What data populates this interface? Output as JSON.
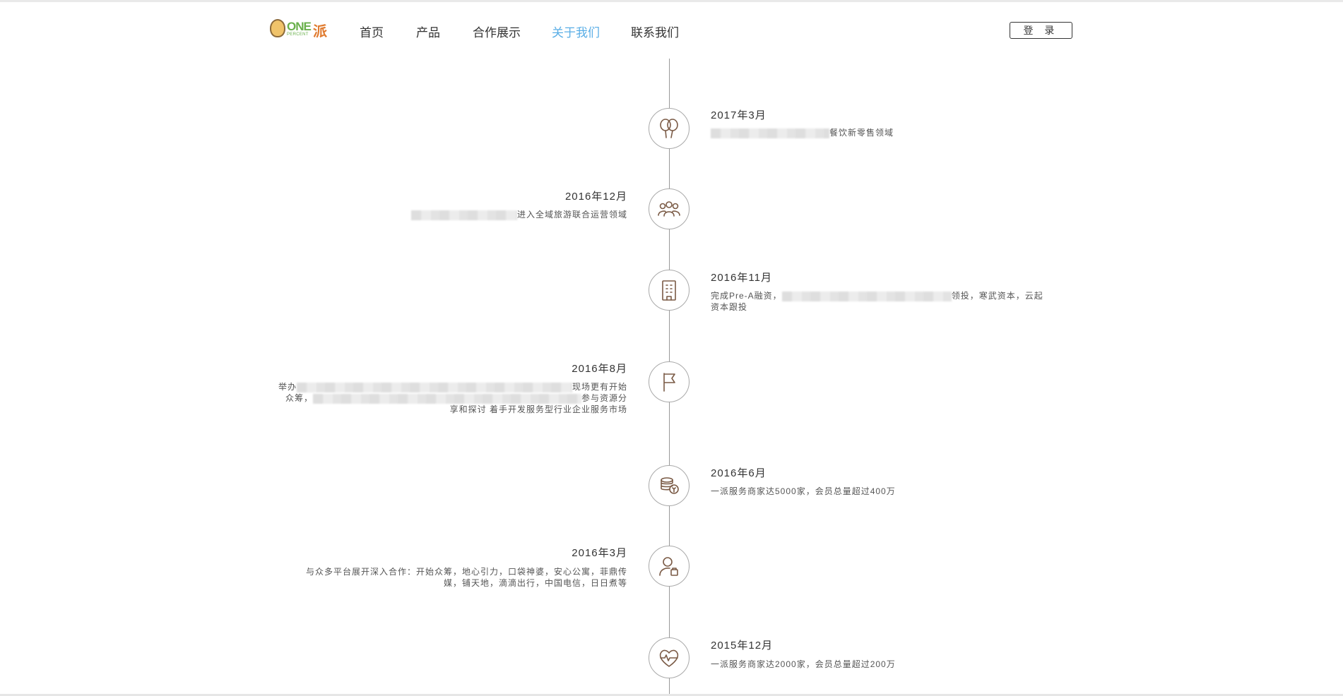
{
  "header": {
    "logo": {
      "one": "ONE",
      "percent": "PERCENT",
      "pai": "派"
    },
    "nav": [
      {
        "label": "首页",
        "active": false
      },
      {
        "label": "产品",
        "active": false
      },
      {
        "label": "合作展示",
        "active": false
      },
      {
        "label": "关于我们",
        "active": true
      },
      {
        "label": "联系我们",
        "active": false
      }
    ],
    "login_label": "登 录"
  },
  "timeline": [
    {
      "date": "2017年3月",
      "side": "right",
      "icon": "balloons-icon",
      "desc_visible": "餐饮新零售领域"
    },
    {
      "date": "2016年12月",
      "side": "left",
      "icon": "group-icon",
      "desc_visible": "进入全域旅游联合运营领域"
    },
    {
      "date": "2016年11月",
      "side": "right",
      "icon": "building-icon",
      "desc_start": "完成Pre-A融资，",
      "desc_end": "领投，寒武资本，云起",
      "desc_line2": "资本跟投"
    },
    {
      "date": "2016年8月",
      "side": "left",
      "icon": "flag-icon",
      "desc_l1_start": "举办",
      "desc_l1_end": "现场更有开始",
      "desc_l2_start": "众筹，",
      "desc_l2_end": "参与资源分",
      "desc_l3": "享和探讨 着手开发服务型行业企业服务市场"
    },
    {
      "date": "2016年6月",
      "side": "right",
      "icon": "coins-icon",
      "desc": "一派服务商家达5000家，会员总量超过400万"
    },
    {
      "date": "2016年3月",
      "side": "left",
      "icon": "user-bag-icon",
      "desc_line1": "与众多平台展开深入合作：开始众筹，地心引力，口袋神婆，安心公寓，菲鼎传",
      "desc_line2": "媒，铺天地，滴滴出行，中国电信，日日煮等"
    },
    {
      "date": "2015年12月",
      "side": "right",
      "icon": "heart-pulse-icon",
      "desc": "一派服务商家达2000家，会员总量超过200万"
    }
  ],
  "colors": {
    "active_nav": "#5aaee6",
    "icon_stroke": "#7a5a45",
    "line": "#999999"
  }
}
